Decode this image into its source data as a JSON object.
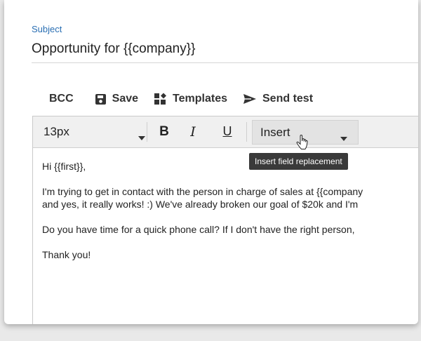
{
  "subject": {
    "label": "Subject",
    "value": "Opportunity for {{company}}"
  },
  "toolbar": {
    "bcc_label": "BCC",
    "save_label": "Save",
    "templates_label": "Templates",
    "send_test_label": "Send test"
  },
  "format_bar": {
    "font_size": "13px",
    "bold": "B",
    "italic": "I",
    "underline": "U",
    "insert_label": "Insert",
    "tooltip": "Insert field replacement"
  },
  "body": {
    "greeting": "Hi {{first}},",
    "para1_line1": "I'm trying to get in contact with the person in charge of sales at {{company",
    "para1_line2": "and yes, it really works! :) We've already broken our goal of $20k and I'm",
    "para2": "Do you have time for a quick phone call? If I don't have the right person,",
    "closing": "Thank you!"
  },
  "colors": {
    "subject_label": "#2a6fb3",
    "tooltip_bg": "#3a3a3a"
  },
  "icons": [
    "save-icon",
    "templates-icon",
    "send-icon",
    "caret-down-icon",
    "hand-cursor-icon"
  ]
}
